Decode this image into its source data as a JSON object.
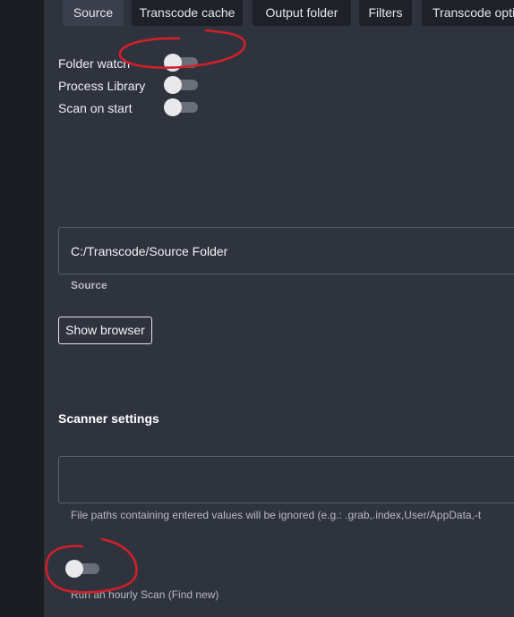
{
  "tabs": [
    {
      "label": "Source",
      "active": true
    },
    {
      "label": "Transcode cache",
      "active": false
    },
    {
      "label": "Output folder",
      "active": false
    },
    {
      "label": "Filters",
      "active": false
    },
    {
      "label": "Transcode opti",
      "active": false
    }
  ],
  "toggles": {
    "folder_watch": {
      "label": "Folder watch",
      "on": false
    },
    "process_library": {
      "label": "Process Library",
      "on": false
    },
    "scan_on_start": {
      "label": "Scan on start",
      "on": false
    }
  },
  "source_field": {
    "value": "C:/Transcode/Source Folder",
    "helper": "Source"
  },
  "show_browser_button": {
    "label": "Show browser"
  },
  "scanner": {
    "heading": "Scanner settings",
    "ignore_field": {
      "value": "",
      "helper": "File paths containing entered values will be ignored (e.g.: .grab,.index,User/AppData,-t"
    },
    "hourly_scan": {
      "label": "Run an hourly Scan (Find new)",
      "on": false
    }
  },
  "annotation_color": "#d0202a",
  "colors": {
    "sidebar": "#1c1d22",
    "panel": "#2f333e",
    "tab": "#1f2128",
    "tab_active": "#3b3f4b"
  }
}
